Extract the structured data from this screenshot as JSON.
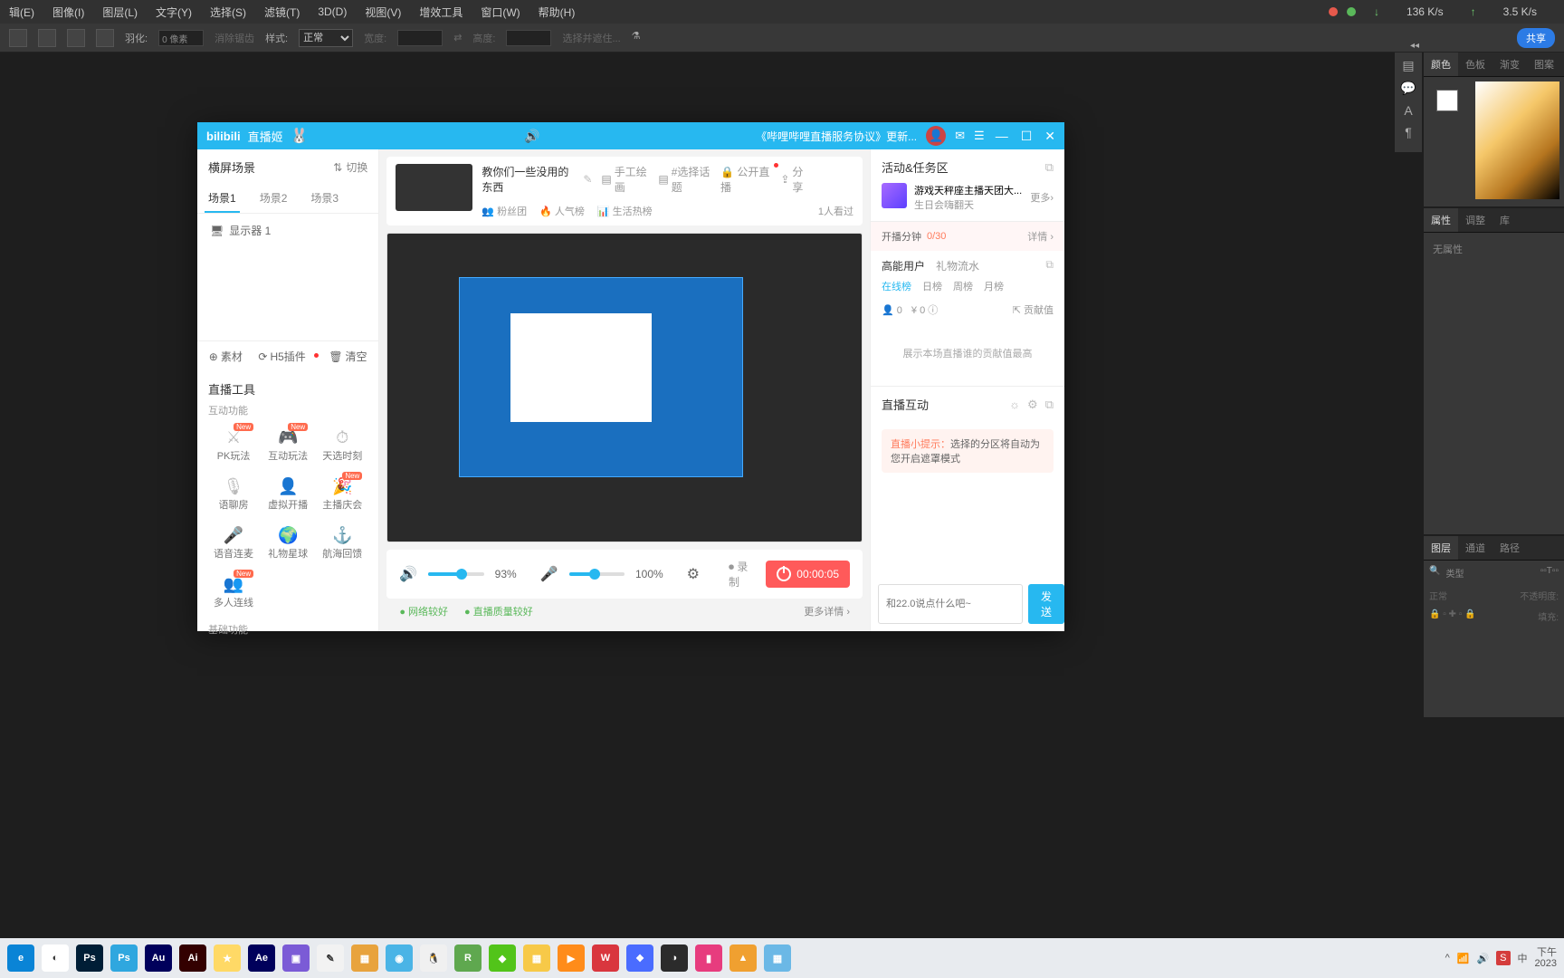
{
  "ps_menu": {
    "items": [
      "辑(E)",
      "图像(I)",
      "图层(L)",
      "文字(Y)",
      "选择(S)",
      "滤镜(T)",
      "3D(D)",
      "视图(V)",
      "增效工具",
      "窗口(W)",
      "帮助(H)"
    ],
    "net_down": "136 K/s",
    "net_up": "3.5 K/s"
  },
  "ps_opts": {
    "feather_label": "羽化:",
    "feather_val": "0 像素",
    "anti": "消除锯齿",
    "style_label": "样式:",
    "style_val": "正常",
    "width_label": "宽度:",
    "height_label": "高度:",
    "mask": "选择并遮住...",
    "share": "共享"
  },
  "ps_panels": {
    "color": [
      "颜色",
      "色板",
      "渐变",
      "图案"
    ],
    "props": [
      "属性",
      "调整",
      "库"
    ],
    "props_empty": "无属性",
    "layers": [
      "图层",
      "通道",
      "路径"
    ],
    "layer_filter": "类型",
    "layer_mode": "正常",
    "opacity": "不透明度:",
    "fill": "填充:"
  },
  "bili": {
    "logo": "bilibili",
    "app": "直播姬",
    "marquee": "《哔哩哔哩直播服务协议》更新...",
    "avatar": "👤",
    "scene_title": "横屏场景",
    "switch": "切换",
    "scene_tabs": [
      "场景1",
      "场景2",
      "场景3"
    ],
    "source": "显示器 1",
    "bottom_tabs": {
      "material": "素材",
      "h5": "H5插件",
      "clear": "清空"
    },
    "tools_title": "直播工具",
    "interactive": "互动功能",
    "basic": "基础功能",
    "tool_items": [
      {
        "n": "PK玩法",
        "new": true
      },
      {
        "n": "互动玩法",
        "new": true
      },
      {
        "n": "天选时刻"
      },
      {
        "n": "语聊房"
      },
      {
        "n": "虚拟开播"
      },
      {
        "n": "主播庆会",
        "new": true
      },
      {
        "n": "语音连麦"
      },
      {
        "n": "礼物星球"
      },
      {
        "n": "航海回馈"
      },
      {
        "n": "多人连线",
        "new": true
      }
    ],
    "stream": {
      "title": "教你们一些没用的东西",
      "tags": [
        "手工绘画",
        "#选择话题",
        "公开直播"
      ],
      "share": "分享",
      "fans": "粉丝团",
      "pop": "人气榜",
      "life": "生活热榜",
      "viewers": "1人看过",
      "vol_speaker": "93%",
      "vol_mic": "100%",
      "record": "录制",
      "rec_time": "00:00:05",
      "net": "网络较好",
      "quality": "直播质量较好",
      "more": "更多详情"
    },
    "right": {
      "activity": "活动&任务区",
      "more": "更多",
      "act_title": "游戏天秤座主播天团大...",
      "act_sub": "生日会嗨翻天",
      "timer_label": "开播分钟",
      "timer_val": "0/30",
      "detail": "详情",
      "energy": "高能用户",
      "gift": "礼物流水",
      "rank_tabs": [
        "在线榜",
        "日榜",
        "周榜",
        "月榜"
      ],
      "people": "0",
      "coin": "0",
      "contrib": "贡献值",
      "rank_empty": "展示本场直播谁的贡献值最高",
      "chat": "直播互动",
      "tip_label": "直播小提示：",
      "tip_text": "选择的分区将自动为您开启遮罩模式",
      "input_ph": "和22.0说点什么吧~",
      "send": "发送"
    }
  },
  "taskbar": {
    "apps": [
      {
        "c": "#0a84d6",
        "t": "e"
      },
      {
        "c": "#fff",
        "t": "◐"
      },
      {
        "c": "#001e36",
        "t": "Ps"
      },
      {
        "c": "#2fa7df",
        "t": "Ps"
      },
      {
        "c": "#00005b",
        "t": "Au"
      },
      {
        "c": "#330000",
        "t": "Ai"
      },
      {
        "c": "#ffd966",
        "t": "★"
      },
      {
        "c": "#00005b",
        "t": "Ae"
      },
      {
        "c": "#7b5bd6",
        "t": "▣"
      },
      {
        "c": "#f2f2f2",
        "t": "✎"
      },
      {
        "c": "#e8a33d",
        "t": "▦"
      },
      {
        "c": "#4ab4e6",
        "t": "◉"
      },
      {
        "c": "#f0f0f0",
        "t": "🐧"
      },
      {
        "c": "#5fa84f",
        "t": "R"
      },
      {
        "c": "#52c41a",
        "t": "◆"
      },
      {
        "c": "#f7c948",
        "t": "▦"
      },
      {
        "c": "#ff8c1a",
        "t": "▶"
      },
      {
        "c": "#d9363e",
        "t": "W"
      },
      {
        "c": "#4a6cff",
        "t": "❖"
      },
      {
        "c": "#2b2b2b",
        "t": "◑"
      },
      {
        "c": "#e73c7e",
        "t": "▮"
      },
      {
        "c": "#f0a030",
        "t": "▲"
      },
      {
        "c": "#6bb8e6",
        "t": "▦"
      }
    ],
    "ime": "S",
    "lang": "中",
    "time_label": "下午",
    "date_label": "2023"
  }
}
